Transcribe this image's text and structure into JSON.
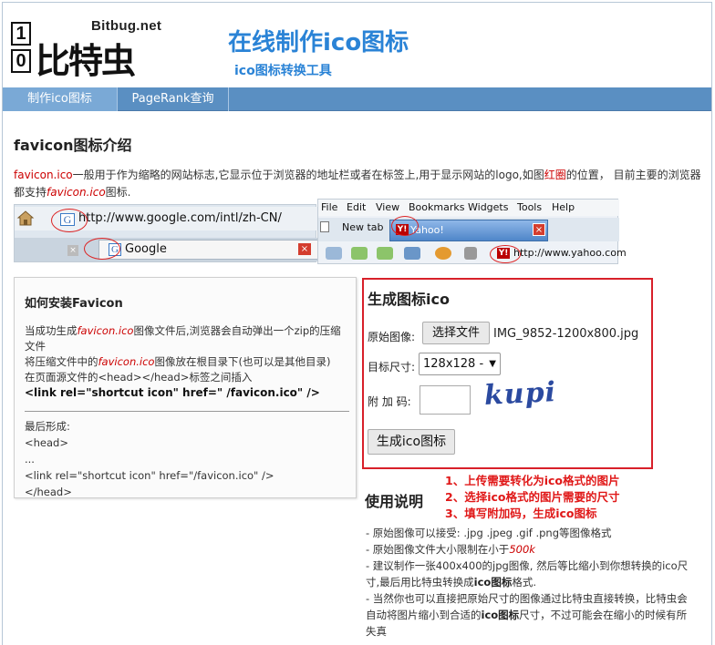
{
  "logo": {
    "digit1": "1",
    "digit2": "0",
    "name_cn": "比特虫",
    "name_en": "Bitbug.net"
  },
  "header": {
    "title": "在线制作ico图标",
    "subtitle": "ico图标转换工具"
  },
  "nav": {
    "items": [
      "制作ico图标",
      "PageRank查询"
    ]
  },
  "intro": {
    "heading": "favicon图标介绍",
    "term": "favicon.ico",
    "text1": "一般用于作为缩略的网站标志,它显示位于浏览器的地址栏或者在标签上,用于显示网站的logo,如图",
    "redcircle": "红圈",
    "text2": "的位置， 目前主要的浏览器都支持",
    "term2": "favicon.ico",
    "text3": "图标."
  },
  "illustration": {
    "left_url": "http://www.google.com/intl/zh-CN/",
    "left_tab": "Google",
    "menu": [
      "File",
      "Edit",
      "View",
      "Bookmarks",
      "Widgets",
      "Tools",
      "Help"
    ],
    "new_tab": "New tab",
    "yahoo_tab": "Yahoo!",
    "yahoo_url": "http://www.yahoo.com"
  },
  "install": {
    "title": "如何安装Favicon",
    "l1a": "当成功生成",
    "l1b": "favicon.ico",
    "l1c": "图像文件后,浏览器会自动弹出一个zip的压缩文件",
    "l2a": "将压缩文件中的",
    "l2b": "favicon.ico",
    "l2c": "图像放在根目录下(也可以是其他目录)",
    "l3": "在页面源文件的<head></head>标签之间插入",
    "code": "<link rel=\"shortcut icon\" href=\" /favicon.ico\" />",
    "final_label": "最后形成:",
    "f1": "<head>",
    "f2": "...",
    "f3": "<link rel=\"shortcut icon\" href=\"/favicon.ico\" />",
    "f4": "</head>"
  },
  "generator": {
    "title": "生成图标ico",
    "source_label": "原始图像:",
    "choose_button": "选择文件",
    "file_name": "IMG_9852-1200x800.jpg",
    "size_label": "目标尺寸:",
    "size_value": "128x128 -",
    "code_label": "附 加 码:",
    "code_value": "",
    "captcha": "kupi",
    "submit_button": "生成ico图标"
  },
  "usage": {
    "title": "使用说明",
    "steps": [
      "1、上传需要转化为ico格式的图片",
      "2、选择ico格式的图片需要的尺寸",
      "3、填写附加码，生成ico图标"
    ],
    "n1": "- 原始图像可以接受: .jpg .jpeg .gif .png等图像格式",
    "n2a": "- 原始图像文件大小限制在小于",
    "n2b": "500k",
    "n3a": "- 建议制作一张400x400的jpg图像, 然后等比缩小到你想转换的ico尺寸,最后用比特虫转换成",
    "n3b": "ico图标",
    "n3c": "格式.",
    "n4a": "- 当然你也可以直接把原始尺寸的图像通过比特虫直接转换，比特虫会自动将图片缩小到合适的",
    "n4b": "ico图标",
    "n4c": "尺寸，不过可能会在缩小的时候有所失真"
  }
}
